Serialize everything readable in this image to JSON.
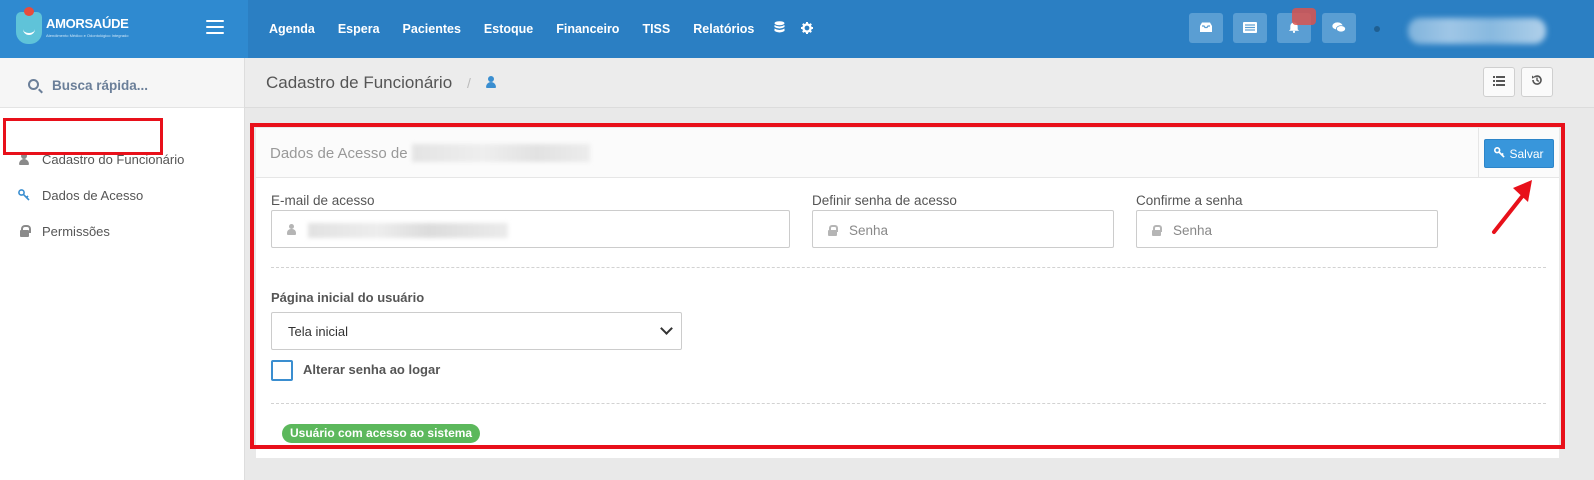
{
  "app": {
    "brand_name": "AMORSAÚDE",
    "brand_tagline": "Atendimento Médico e Odontológico Integrado"
  },
  "nav": {
    "items": [
      "Agenda",
      "Espera",
      "Pacientes",
      "Estoque",
      "Financeiro",
      "TISS",
      "Relatórios"
    ],
    "extra_icons": [
      "database-icon",
      "gear-icon"
    ],
    "toolbar_icons": [
      "inbox-icon",
      "list-icon",
      "bell-icon",
      "chat-icon"
    ]
  },
  "sidebar": {
    "search_placeholder": "Busca rápida...",
    "items": [
      {
        "label": "Cadastro do Funcionário",
        "icon": "user-icon",
        "active": false
      },
      {
        "label": "Dados de Acesso",
        "icon": "key-icon",
        "active": true
      },
      {
        "label": "Permissões",
        "icon": "lock-icon",
        "active": false
      }
    ]
  },
  "header": {
    "title": "Cadastro de Funcionário",
    "separator": "/"
  },
  "panel": {
    "title": "Dados de Acesso de",
    "save_label": "Salvar",
    "email_label": "E-mail de acesso",
    "password_label": "Definir senha de acesso",
    "password_placeholder": "Senha",
    "confirm_label": "Confirme a senha",
    "confirm_placeholder": "Senha",
    "home_page_label": "Página inicial do usuário",
    "home_page_value": "Tela inicial",
    "change_password_label": "Alterar senha ao logar",
    "change_password_checked": false,
    "status_badge": "Usuário com acesso ao sistema"
  },
  "colors": {
    "navbar": "#2b7fc3",
    "accent": "#3896db",
    "highlight": "#e8101a",
    "success": "#5cb85c"
  }
}
